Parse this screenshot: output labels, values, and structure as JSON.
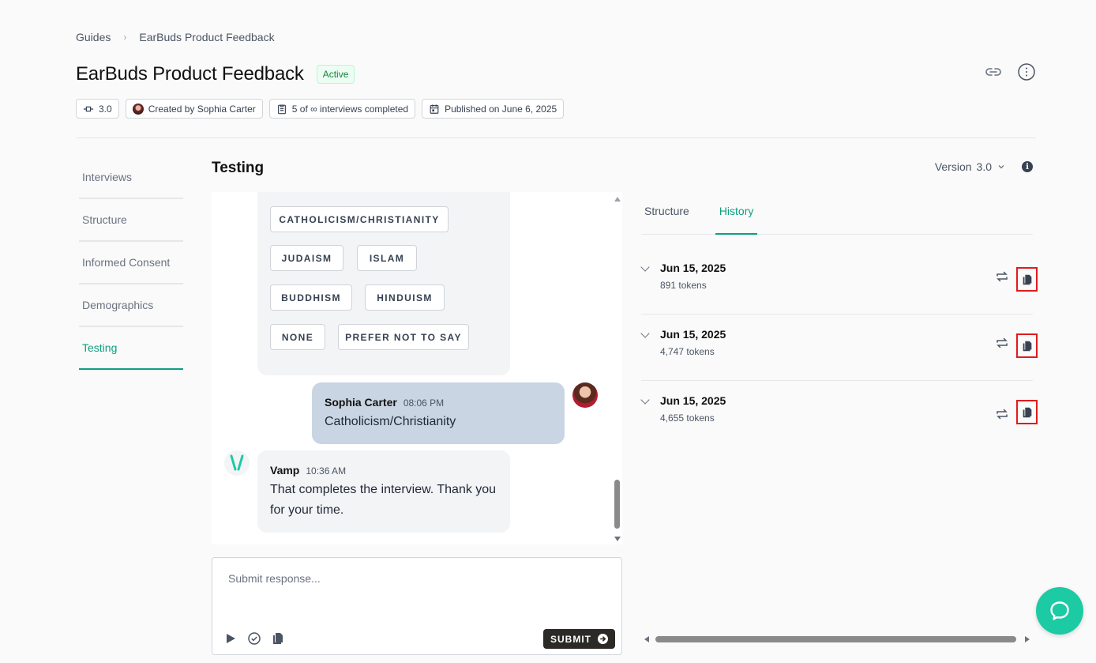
{
  "breadcrumb": {
    "root": "Guides",
    "current": "EarBuds Product Feedback"
  },
  "guide": {
    "title": "EarBuds Product Feedback",
    "status": "Active"
  },
  "meta": {
    "version": "3.0",
    "created_by": "Created by Sophia Carter",
    "interviews": "5 of ∞ interviews completed",
    "published": "Published on June 6, 2025"
  },
  "side_nav": {
    "items": [
      {
        "label": "Interviews"
      },
      {
        "label": "Structure"
      },
      {
        "label": "Informed Consent"
      },
      {
        "label": "Demographics"
      },
      {
        "label": "Testing"
      }
    ],
    "active": "Testing"
  },
  "testing": {
    "title": "Testing",
    "version_label": "Version",
    "version_value": "3.0"
  },
  "chat": {
    "options": [
      "CATHOLICISM/CHRISTIANITY",
      "JUDAISM",
      "ISLAM",
      "BUDDHISM",
      "HINDUISM",
      "NONE",
      "PREFER NOT TO SAY"
    ],
    "user_message": {
      "name": "Sophia Carter",
      "time": "08:06 PM",
      "text": "Catholicism/Christianity"
    },
    "bot_message": {
      "name": "Vamp",
      "time": "10:36 AM",
      "text": "That completes the interview. Thank you for your time."
    }
  },
  "composer": {
    "placeholder": "Submit response...",
    "submit_label": "SUBMIT"
  },
  "right_panel": {
    "tabs": [
      {
        "label": "Structure"
      },
      {
        "label": "History"
      }
    ],
    "active_tab": "History",
    "history": [
      {
        "date": "Jun 15, 2025",
        "tokens": "891 tokens"
      },
      {
        "date": "Jun 15, 2025",
        "tokens": "4,747 tokens"
      },
      {
        "date": "Jun 15, 2025",
        "tokens": "4,655 tokens"
      }
    ]
  },
  "colors": {
    "accent": "#0e9f7e",
    "fab": "#1ccaa4",
    "highlight_box": "#e01b1b",
    "user_bubble": "#c9d5e2"
  }
}
